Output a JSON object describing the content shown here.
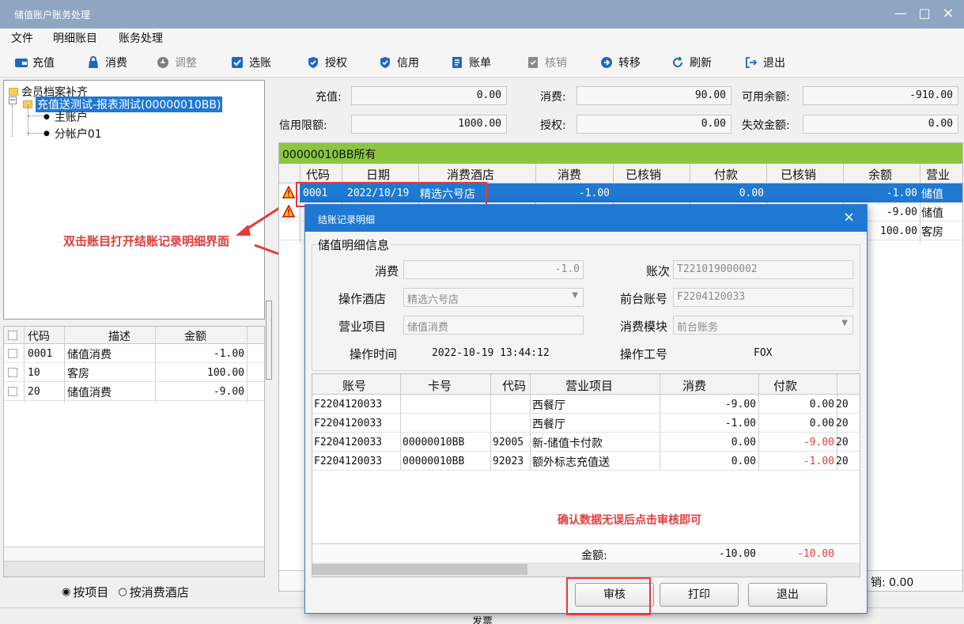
{
  "window": {
    "title": "储值账户账务处理",
    "controls": [
      "—",
      "□",
      "×"
    ]
  },
  "menu": [
    "文件",
    "明细账目",
    "账务处理"
  ],
  "toolbar": {
    "recharge": "充值",
    "consume": "消费",
    "adjust": "调整",
    "select_account": "选账",
    "authorize": "授权",
    "credit": "信用",
    "bill": "账单",
    "writeoff": "核销",
    "transfer": "转移",
    "refresh": "刷新",
    "exit": "退出"
  },
  "tree": {
    "root": "会员档案补齐",
    "account": "充值送测试-报表测试(00000010BB)",
    "main_account": "主账户",
    "sub_account": "分帐户01"
  },
  "left_grid": {
    "headers": [
      "代码",
      "描述",
      "金额"
    ],
    "rows": [
      {
        "code": "0001",
        "desc": "储值消费",
        "amount": "-1.00"
      },
      {
        "code": "10",
        "desc": "客房",
        "amount": "100.00"
      },
      {
        "code": "20",
        "desc": "储值消费",
        "amount": "-9.00"
      }
    ]
  },
  "group_by": {
    "by_item": "按项目",
    "by_hotel": "按消费酒店"
  },
  "summary": {
    "recharge_label": "充值:",
    "recharge_value": "0.00",
    "consume_label": "消费:",
    "consume_value": "90.00",
    "available_label": "可用余额:",
    "available_value": "-910.00",
    "credit_label": "信用限额:",
    "credit_value": "1000.00",
    "auth_label": "授权:",
    "auth_value": "0.00",
    "expired_label": "失效金额:",
    "expired_value": "0.00"
  },
  "records": {
    "group_title": "00000010BB所有",
    "headers": [
      "代码",
      "日期",
      "消费酒店",
      "消费",
      "已核销",
      "付款",
      "已核销",
      "余额",
      "营业"
    ],
    "rows": [
      {
        "code": "0001",
        "date": "2022/10/19",
        "hotel": "精选六号店",
        "consume": "-1.00",
        "verified": "",
        "payment": "0.00",
        "verified2": "",
        "balance": "-1.00",
        "item": "储值"
      },
      {
        "balance": "-9.00",
        "item": "储值"
      },
      {
        "balance": "100.00",
        "item": "客房"
      }
    ],
    "footer_verified": "销: 0.00"
  },
  "status": {
    "invoice": "发票"
  },
  "annotations": {
    "double_click": "双击账目打开结账记录明细界面",
    "confirm": "确认数据无误后点击审核即可"
  },
  "dialog": {
    "title": "结账记录明细",
    "group_label": "储值明细信息",
    "consume_label": "消费",
    "consume_value": "-1.0",
    "bill_no_label": "账次",
    "bill_no_value": "T221019000002",
    "hotel_label": "操作酒店",
    "hotel_value": "精选六号店",
    "front_account_label": "前台账号",
    "front_account_value": "F2204120033",
    "business_label": "营业项目",
    "business_value": "储值消费",
    "module_label": "消费模块",
    "module_value": "前台账务",
    "time_label": "操作时间",
    "time_value": "2022-10-19 13:44:12",
    "operator_label": "操作工号",
    "operator_value": "FOX",
    "table": {
      "headers": [
        "账号",
        "卡号",
        "代码",
        "营业项目",
        "消费",
        "付款"
      ],
      "rows": [
        {
          "account": "F2204120033",
          "card": "",
          "code": "",
          "item": "西餐厅",
          "consume": "-9.00",
          "pay": "0.00",
          "extra": "20",
          "pay_red": false
        },
        {
          "account": "F2204120033",
          "card": "",
          "code": "",
          "item": "西餐厅",
          "consume": "-1.00",
          "pay": "0.00",
          "extra": "20",
          "pay_red": false
        },
        {
          "account": "F2204120033",
          "card": "00000010BB",
          "code": "92005",
          "item": "新-储值卡付款",
          "consume": "0.00",
          "pay": "-9.00",
          "extra": "20",
          "pay_red": true
        },
        {
          "account": "F2204120033",
          "card": "00000010BB",
          "code": "92023",
          "item": "额外标志充值送",
          "consume": "0.00",
          "pay": "-1.00",
          "extra": "20",
          "pay_red": true
        }
      ],
      "total_label": "金额:",
      "total_consume": "-10.00",
      "total_pay": "-10.00"
    },
    "buttons": {
      "audit": "审核",
      "print": "打印",
      "exit": "退出"
    }
  },
  "colors": {
    "selection": "#1f78d1",
    "group_bar": "#8cc63f",
    "annotation": "#e53a3a",
    "titlebar": "#8ea6c2"
  }
}
